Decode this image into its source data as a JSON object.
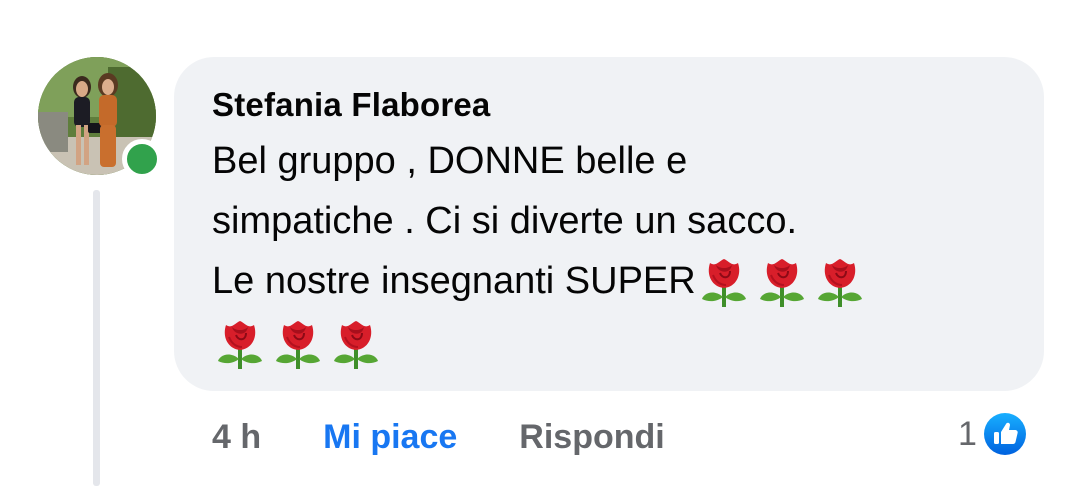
{
  "comment": {
    "author": "Stefania Flaborea",
    "text_lines": [
      "Bel gruppo , DONNE belle e",
      "simpatiche . Ci si diverte un sacco.",
      "Le nostre insegnanti SUPER"
    ],
    "emoji_name": "rose-emoji",
    "emoji_count_line3": 3,
    "emoji_count_line4": 3,
    "online": true
  },
  "actions": {
    "time": "4 h",
    "like_label": "Mi piace",
    "reply_label": "Rispondi",
    "reaction_count": "1",
    "reaction_icon": "thumbs-up-icon"
  },
  "colors": {
    "bubble": "#f0f2f5",
    "like_blue": "#1877f2",
    "meta_gray": "#65676b",
    "online_green": "#31a24c"
  }
}
